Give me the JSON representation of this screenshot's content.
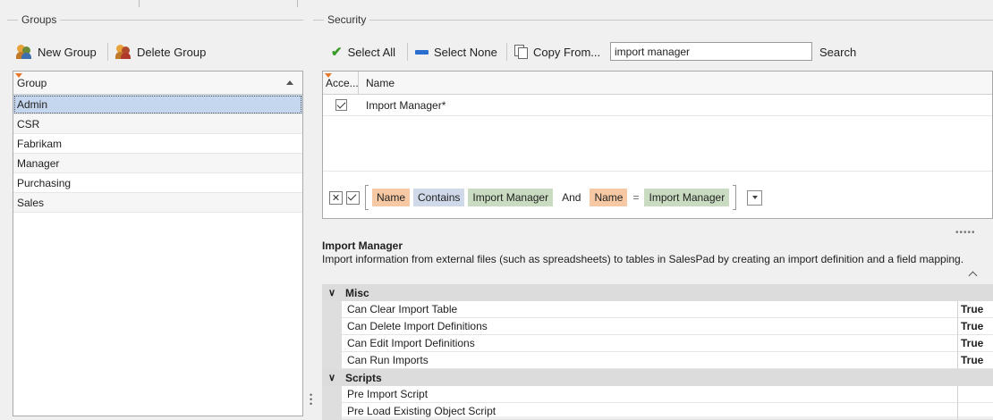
{
  "groups_panel": {
    "title": "Groups",
    "toolbar": {
      "new_group": "New Group",
      "delete_group": "Delete Group"
    },
    "column_header": "Group",
    "rows": [
      "Admin",
      "CSR",
      "Fabrikam",
      "Manager",
      "Purchasing",
      "Sales"
    ],
    "selected": "Admin"
  },
  "security_panel": {
    "title": "Security",
    "toolbar": {
      "select_all": "Select All",
      "select_none": "Select None",
      "copy_from": "Copy From...",
      "search_value": "import manager",
      "search_button": "Search"
    },
    "columns": {
      "access": "Acce...",
      "name": "Name"
    },
    "rows": [
      {
        "checked": true,
        "name": "Import Manager*"
      }
    ],
    "filter": {
      "field1": "Name",
      "op1": "Contains",
      "val1": "Import Manager",
      "conj": "And",
      "field2": "Name",
      "op2": "=",
      "val2": "Import Manager"
    }
  },
  "description": {
    "title": "Import Manager",
    "text": "Import information from external files (such as spreadsheets) to tables in SalesPad by creating an import definition and a field mapping."
  },
  "properties": {
    "categories": [
      {
        "name": "Misc",
        "items": [
          {
            "name": "Can Clear Import Table",
            "value": "True"
          },
          {
            "name": "Can Delete Import Definitions",
            "value": "True"
          },
          {
            "name": "Can Edit Import Definitions",
            "value": "True"
          },
          {
            "name": "Can Run Imports",
            "value": "True"
          }
        ]
      },
      {
        "name": "Scripts",
        "items": [
          {
            "name": "Pre Import Script",
            "value": ""
          },
          {
            "name": "Pre Load Existing Object Script",
            "value": ""
          }
        ]
      }
    ]
  },
  "colors": {
    "selection": "#c5d7ee",
    "field_token": "#f6c9a4",
    "op_token": "#cfd9ea",
    "value_token": "#c9dcc1",
    "checkmark_green": "#3a9a2a",
    "select_none_blue": "#2a6fd0"
  }
}
